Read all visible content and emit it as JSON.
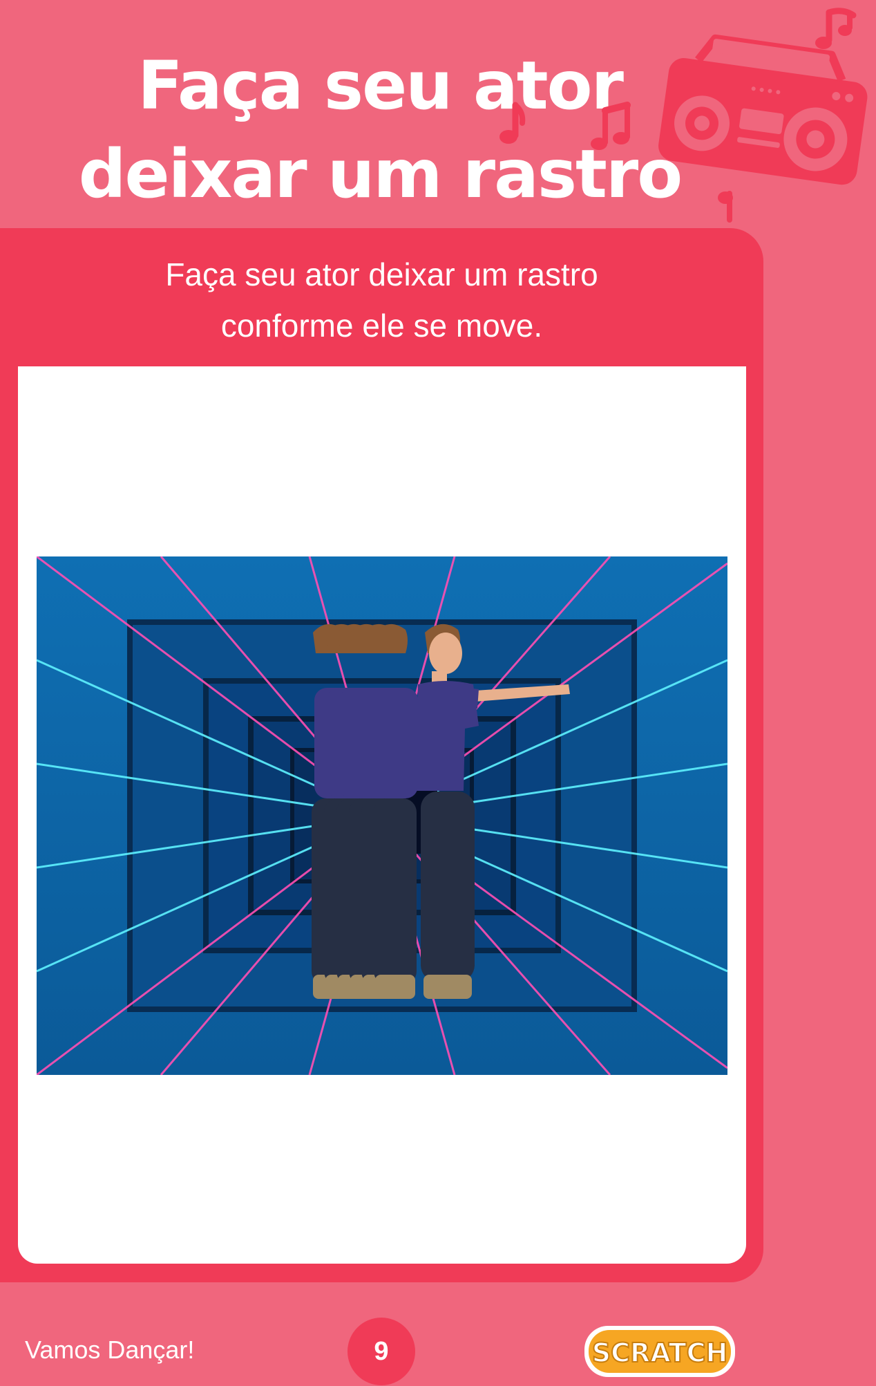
{
  "header": {
    "title_line1": "Faça seu ator",
    "title_line2": "deixar um rastro"
  },
  "card": {
    "text_line1": "Faça seu ator deixar um rastro",
    "text_line2": "conforme ele se move."
  },
  "footer": {
    "label": "Vamos Dançar!",
    "page_number": "9",
    "logo_text": "SCRATCH"
  },
  "colors": {
    "page_background": "#f0667d",
    "card_background": "#f03b57",
    "panel_background": "#ffffff",
    "stage_blue": "#0a5c9a",
    "logo_orange": "#f6a623"
  },
  "icons": {
    "header_decoration": "boombox-icon",
    "music_notes": "music-note-icon",
    "logo": "scratch-logo"
  }
}
